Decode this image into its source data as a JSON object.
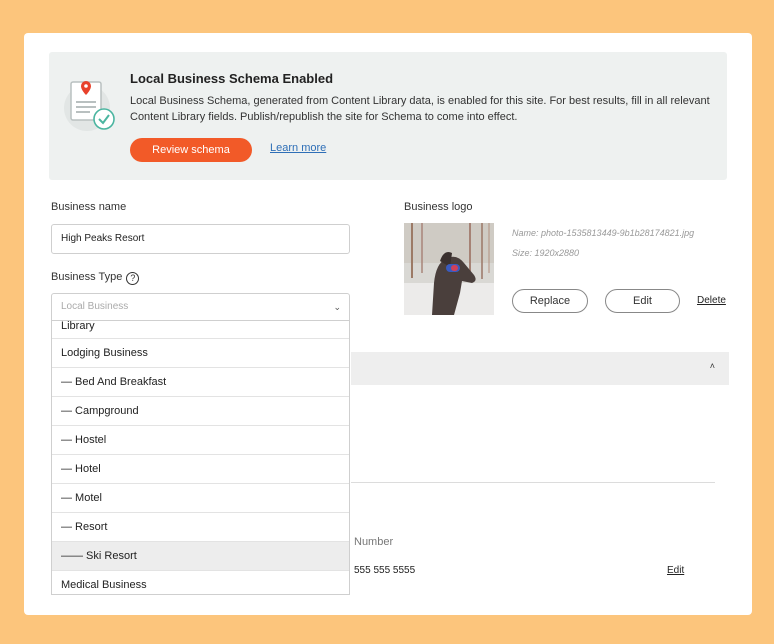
{
  "banner": {
    "title": "Local Business Schema Enabled",
    "text": "Local Business Schema, generated from Content Library data, is enabled for this site. For best results, fill in all relevant Content Library fields. Publish/republish the site for Schema to come into effect.",
    "review_label": "Review schema",
    "learn_label": "Learn more",
    "icon": "document-check-icon"
  },
  "business_name": {
    "label": "Business name",
    "value": "High Peaks Resort"
  },
  "business_type": {
    "label": "Business Type",
    "help_icon": "?",
    "placeholder": "Local Business",
    "chevron": "⌄",
    "options": [
      "Library",
      "Lodging Business",
      "— Bed And Breakfast",
      "— Campground",
      "— Hostel",
      "— Hotel",
      "— Motel",
      "— Resort",
      "—— Ski Resort",
      "Medical Business"
    ],
    "highlighted": "—— Ski Resort"
  },
  "logo": {
    "label": "Business logo",
    "name": "Name: photo-1535813449-9b1b28174821.jpg",
    "size": "Size: 1920x2880",
    "replace_label": "Replace",
    "edit_label": "Edit",
    "delete_label": "Delete"
  },
  "section": {
    "caret": "˄"
  },
  "phone": {
    "label": "Number",
    "value": "555 555 5555",
    "edit_label": "Edit"
  },
  "colors": {
    "accent": "#f25a28",
    "background": "#fcc57c",
    "link": "#2e6fb7"
  }
}
